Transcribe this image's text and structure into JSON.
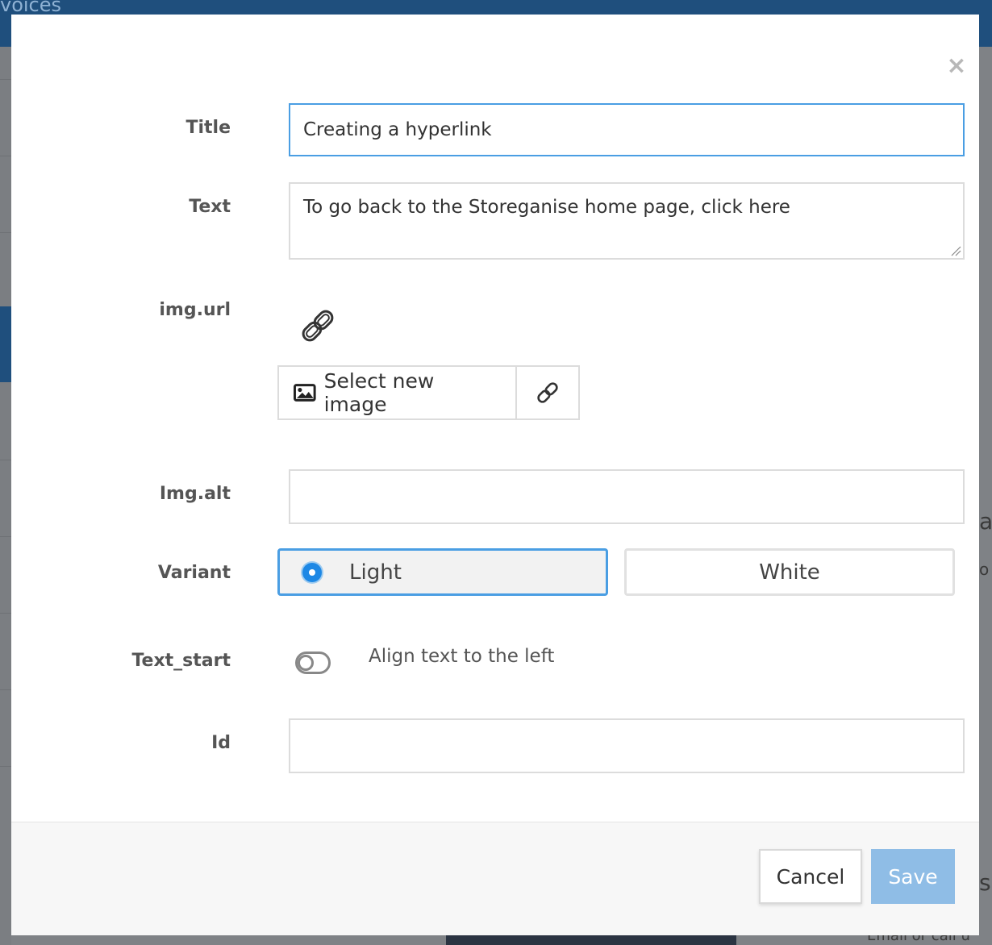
{
  "background": {
    "topbar_fragment": "voices",
    "right_fragments": [
      "a",
      "o",
      "s"
    ],
    "bottom_fragment": "Email or call u"
  },
  "modal": {
    "close_glyph": "×",
    "fields": {
      "title": {
        "label": "Title",
        "value": "Creating a hyperlink"
      },
      "text": {
        "label": "Text",
        "value": "To go back to the Storeganise home page, click here"
      },
      "img_url": {
        "label": "img.url",
        "select_button": "Select new image"
      },
      "img_alt": {
        "label": "Img.alt",
        "value": ""
      },
      "variant": {
        "label": "Variant",
        "options": [
          "Light",
          "White"
        ],
        "selected": "Light"
      },
      "text_start": {
        "label": "Text_start",
        "toggle_label": "Align text to the left",
        "enabled": false
      },
      "id": {
        "label": "Id",
        "value": ""
      }
    },
    "footer": {
      "cancel": "Cancel",
      "save": "Save"
    }
  },
  "colors": {
    "focus_border": "#4a9ee3",
    "radio_selected": "#1e88e5",
    "save_button": "#8fbde6",
    "topbar": "#1f4f7d"
  },
  "icons": [
    "close-icon",
    "link-icon",
    "image-icon",
    "link-icon"
  ]
}
